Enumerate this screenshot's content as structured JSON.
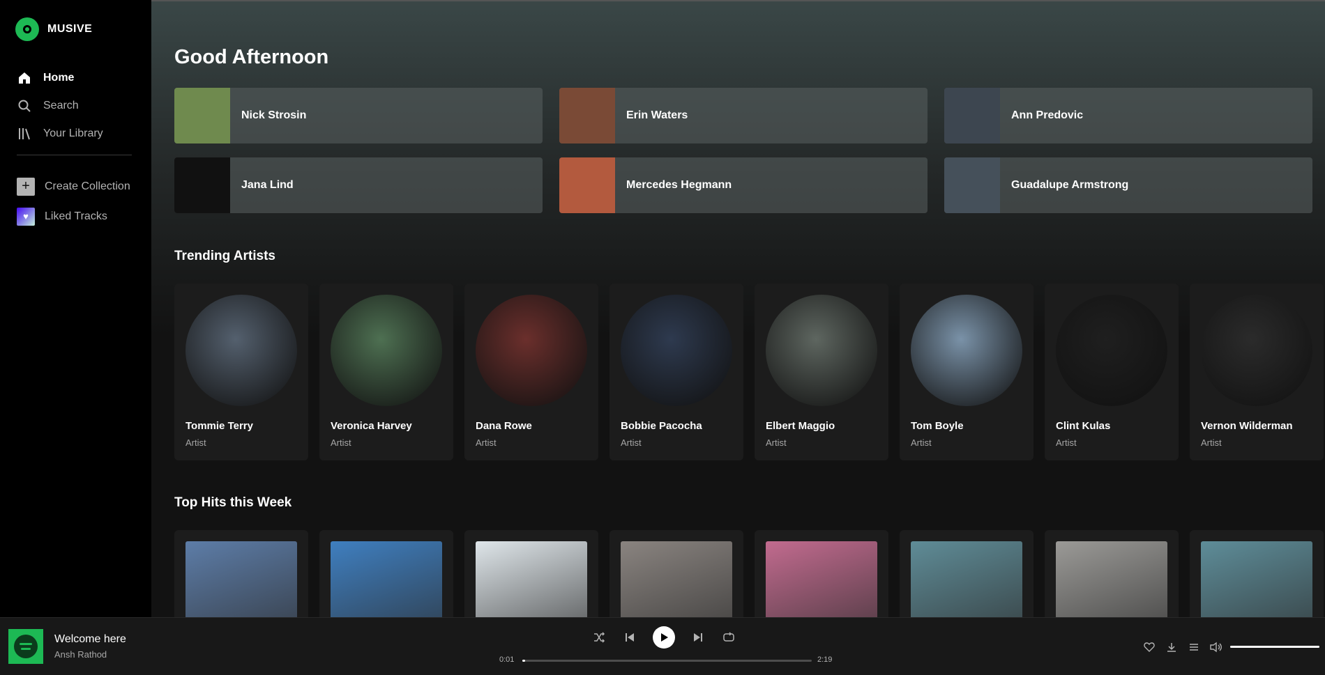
{
  "app": {
    "name": "MUSIVE",
    "logo_icon": "disc-logo-icon",
    "accent_color": "#1db954"
  },
  "sidebar": {
    "nav": [
      {
        "label": "Home",
        "icon": "home-icon",
        "active": true
      },
      {
        "label": "Search",
        "icon": "search-icon",
        "active": false
      },
      {
        "label": "Your Library",
        "icon": "library-icon",
        "active": false
      }
    ],
    "collections": [
      {
        "label": "Create Collection",
        "icon": "plus-icon"
      },
      {
        "label": "Liked Tracks",
        "icon": "heart-icon"
      }
    ]
  },
  "main": {
    "greeting": "Good Afternoon",
    "quick_picks": [
      {
        "name": "Nick Strosin",
        "color": "#6f8a4e"
      },
      {
        "name": "Erin Waters",
        "color": "#7a4a36"
      },
      {
        "name": "Ann Predovic",
        "color": "#3d4650"
      },
      {
        "name": "Jana Lind",
        "color": "#111111"
      },
      {
        "name": "Mercedes Hegmann",
        "color": "#b35a3e"
      },
      {
        "name": "Guadalupe Armstrong",
        "color": "#45505a"
      }
    ],
    "trending_title": "Trending Artists",
    "trending": [
      {
        "name": "Tommie Terry",
        "subtitle": "Artist",
        "color": "#54606e"
      },
      {
        "name": "Veronica Harvey",
        "subtitle": "Artist",
        "color": "#4e7052"
      },
      {
        "name": "Dana Rowe",
        "subtitle": "Artist",
        "color": "#6b2f2c"
      },
      {
        "name": "Bobbie Pacocha",
        "subtitle": "Artist",
        "color": "#2e3a4f"
      },
      {
        "name": "Elbert Maggio",
        "subtitle": "Artist",
        "color": "#5e6660"
      },
      {
        "name": "Tom Boyle",
        "subtitle": "Artist",
        "color": "#7a92a8"
      },
      {
        "name": "Clint Kulas",
        "subtitle": "Artist",
        "color": "#1f1f1f"
      },
      {
        "name": "Vernon Wilderman",
        "subtitle": "Artist",
        "color": "#2b2b2b"
      }
    ],
    "top_hits_title": "Top Hits this Week",
    "top_hits": [
      {
        "color": "#5d7da8"
      },
      {
        "color": "#3f7fc0"
      },
      {
        "color": "#dfe6ea"
      },
      {
        "color": "#8a8480"
      },
      {
        "color": "#c26b8f"
      },
      {
        "color": "#5f8c97"
      },
      {
        "color": "#9b9a97"
      },
      {
        "color": "#5e8d99"
      }
    ]
  },
  "player": {
    "track_title": "Welcome here",
    "track_artist": "Ansh Rathod",
    "current_time": "0:01",
    "total_time": "2:19",
    "progress_fraction": 0.01,
    "volume_fraction": 1.0,
    "control_icons": [
      "shuffle-icon",
      "previous-icon",
      "play-icon",
      "next-icon",
      "repeat-icon"
    ],
    "right_icons": [
      "heart-icon",
      "download-icon",
      "queue-icon",
      "volume-icon"
    ]
  }
}
